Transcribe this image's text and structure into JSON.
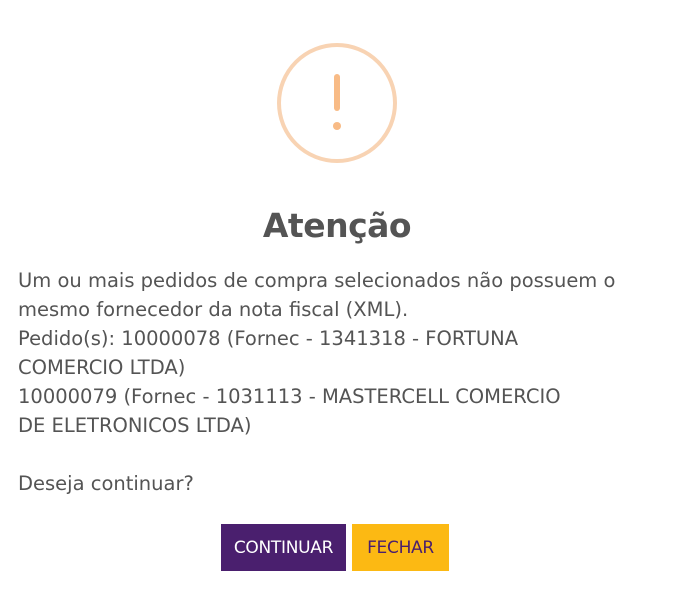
{
  "dialog": {
    "title": "Atenção",
    "icon": "warning-exclamation-icon",
    "message_lines": [
      "Um ou mais pedidos de compra selecionados não possuem o",
      "mesmo fornecedor da nota fiscal (XML).",
      "Pedido(s): 10000078 (Fornec - 1341318 - FORTUNA",
      "COMERCIO LTDA)",
      "10000079 (Fornec - 1031113 - MASTERCELL COMERCIO",
      "DE ELETRONICOS LTDA)"
    ],
    "question": "Deseja continuar?",
    "buttons": {
      "continue_label": "CONTINUAR",
      "close_label": "FECHAR"
    }
  },
  "colors": {
    "icon_border": "#f8d3b3",
    "icon_mark": "#f8bb86",
    "continue_bg": "#4a1f6e",
    "close_bg": "#fcb913",
    "text": "#545454"
  }
}
